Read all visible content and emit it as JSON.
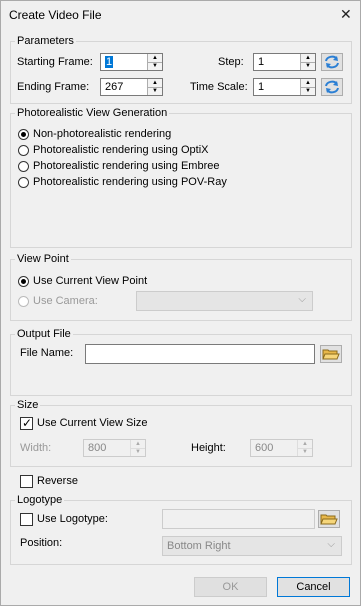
{
  "window": {
    "title": "Create Video File",
    "close_glyph": "✕"
  },
  "parameters": {
    "group_label": "Parameters",
    "starting_frame_label": "Starting Frame:",
    "starting_frame_value": "1",
    "ending_frame_label": "Ending Frame:",
    "ending_frame_value": "267",
    "step_label": "Step:",
    "step_value": "1",
    "time_scale_label": "Time Scale:",
    "time_scale_value": "1",
    "sync_icon": "sync-arrows-icon"
  },
  "photorealistic": {
    "group_label": "Photorealistic View Generation",
    "options": [
      {
        "label": "Non-photorealistic rendering",
        "selected": true
      },
      {
        "label": "Photorealistic rendering using OptiX",
        "selected": false
      },
      {
        "label": "Photorealistic rendering using Embree",
        "selected": false
      },
      {
        "label": "Photorealistic rendering using POV-Ray",
        "selected": false
      }
    ]
  },
  "view_point": {
    "group_label": "View Point",
    "use_current_label": "Use Current View Point",
    "use_camera_label": "Use Camera:",
    "camera_value": ""
  },
  "output_file": {
    "group_label": "Output File",
    "file_name_label": "File Name:",
    "file_name_value": "",
    "browse_icon": "folder-open-icon"
  },
  "size": {
    "group_label": "Size",
    "use_current_label": "Use Current View Size",
    "use_current_checked": true,
    "width_label": "Width:",
    "width_value": "800",
    "height_label": "Height:",
    "height_value": "600"
  },
  "reverse": {
    "label": "Reverse",
    "checked": false
  },
  "logotype": {
    "group_label": "Logotype",
    "use_label": "Use Logotype:",
    "use_checked": false,
    "path_value": "",
    "position_label": "Position:",
    "position_value": "Bottom Right"
  },
  "buttons": {
    "ok": "OK",
    "cancel": "Cancel"
  },
  "colors": {
    "accent": "#0078d7",
    "sync_blue": "#2b7fd4",
    "folder_yellow": "#e8b84a"
  }
}
